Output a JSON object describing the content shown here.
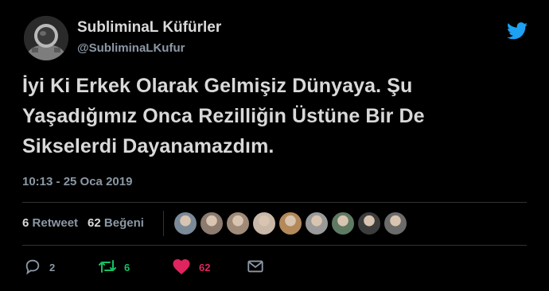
{
  "author": {
    "display_name": "SubliminaL Küfürler",
    "handle": "@SubliminaLKufur",
    "avatar_icon": "astronaut-avatar"
  },
  "brand": {
    "icon": "twitter-bird-icon",
    "color": "#1da1f2"
  },
  "tweet": {
    "lines": [
      "İyi Ki Erkek Olarak Gelmişiz Dünyaya. Şu",
      "Yaşadığımız Onca Rezilliğin Üstüne Bir De",
      "Sikselerdi Dayanamazdım."
    ],
    "timestamp": "10:13 - 25 Oca 2019"
  },
  "stats": {
    "retweet_count": "6",
    "retweet_label": "Retweet",
    "like_count": "62",
    "like_label": "Beğeni"
  },
  "likers": [
    {
      "name": "liker-avatar-1",
      "color": "#7a8a99"
    },
    {
      "name": "liker-avatar-2",
      "color": "#8c7b6e"
    },
    {
      "name": "liker-avatar-3",
      "color": "#a08a78"
    },
    {
      "name": "liker-avatar-4",
      "color": "#c9b8a8"
    },
    {
      "name": "liker-avatar-5",
      "color": "#b3895a"
    },
    {
      "name": "liker-avatar-6",
      "color": "#9a9a9a"
    },
    {
      "name": "liker-avatar-7",
      "color": "#5f7a63"
    },
    {
      "name": "liker-avatar-8",
      "color": "#3d3d3d"
    },
    {
      "name": "liker-avatar-9",
      "color": "#6b6b6b"
    }
  ],
  "actions": {
    "reply_count": "2",
    "retweet_count": "6",
    "like_count": "62",
    "reply_icon": "reply-icon",
    "retweet_icon": "retweet-icon",
    "like_icon": "heart-icon",
    "message_icon": "envelope-icon",
    "reply_color": "#8b98a5",
    "retweet_color": "#17bf63",
    "like_color": "#e0245e"
  }
}
